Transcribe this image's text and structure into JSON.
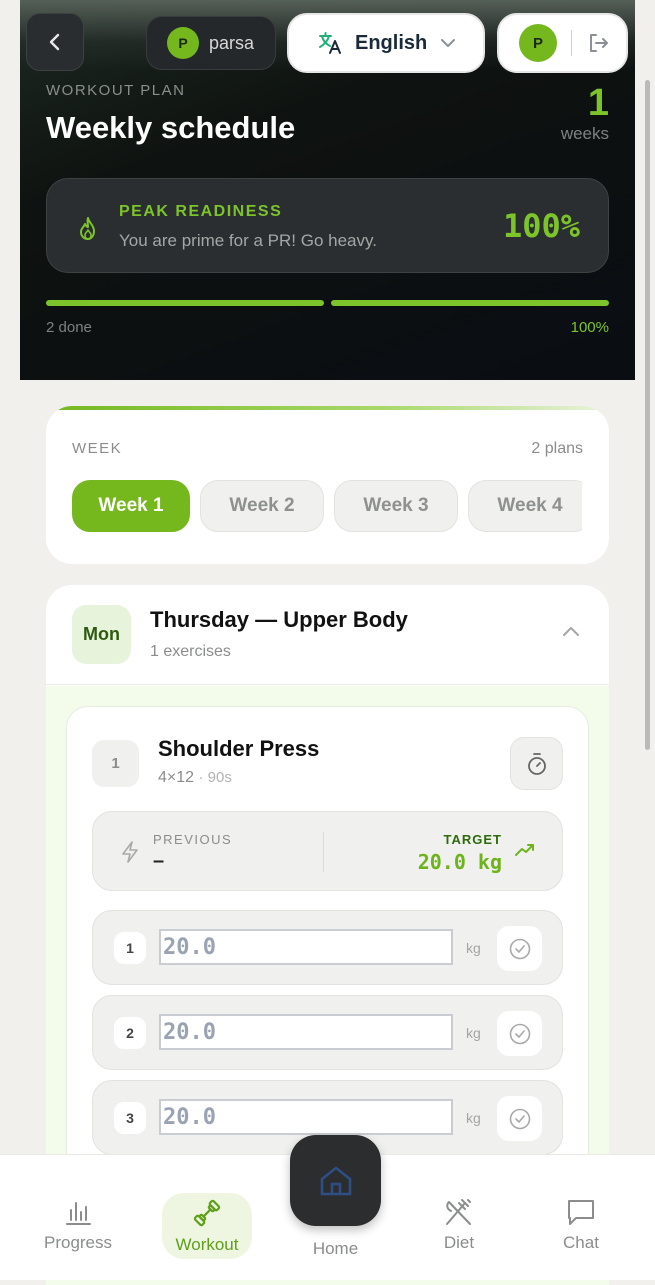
{
  "topbar": {
    "user_initial": "P",
    "user_name": "parsa",
    "language": "English",
    "account_initial": "P"
  },
  "hero": {
    "subtitle": "WORKOUT PLAN",
    "title": "Weekly schedule",
    "weeks_count": "1",
    "weeks_label": "weeks",
    "readiness": {
      "title": "PEAK READINESS",
      "message": "You are prime for a PR! Go heavy.",
      "percent": "100%"
    },
    "progress": {
      "done_label": "2 done",
      "percent_label": "100%",
      "value": 1.0
    }
  },
  "week_selector": {
    "label": "WEEK",
    "plans_count": "2 plans",
    "weeks": [
      "Week 1",
      "Week 2",
      "Week 3",
      "Week 4"
    ],
    "active_index": 0
  },
  "day": {
    "badge": "Mon",
    "title": "Thursday — Upper Body",
    "subtitle": "1 exercises",
    "exercise": {
      "number": "1",
      "name": "Shoulder Press",
      "scheme": "4×12",
      "rest": "· 90s",
      "previous_label": "PREVIOUS",
      "previous_value": "–",
      "target_label": "TARGET",
      "target_value": "20.0 kg",
      "sets": [
        {
          "number": "1",
          "weight": "20.0",
          "unit": "kg"
        },
        {
          "number": "2",
          "weight": "20.0",
          "unit": "kg"
        },
        {
          "number": "3",
          "weight": "20.0",
          "unit": "kg"
        }
      ]
    }
  },
  "nav": {
    "progress": "Progress",
    "workout": "Workout",
    "home": "Home",
    "diet": "Diet",
    "chat": "Chat"
  },
  "colors": {
    "accent": "#74b81e",
    "hero_bg": "#0e1210"
  }
}
